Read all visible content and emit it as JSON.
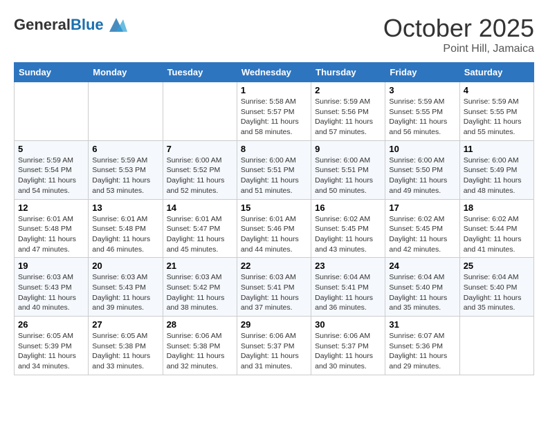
{
  "header": {
    "logo_general": "General",
    "logo_blue": "Blue",
    "month": "October 2025",
    "location": "Point Hill, Jamaica"
  },
  "weekdays": [
    "Sunday",
    "Monday",
    "Tuesday",
    "Wednesday",
    "Thursday",
    "Friday",
    "Saturday"
  ],
  "weeks": [
    [
      {
        "day": "",
        "info": ""
      },
      {
        "day": "",
        "info": ""
      },
      {
        "day": "",
        "info": ""
      },
      {
        "day": "1",
        "info": "Sunrise: 5:58 AM\nSunset: 5:57 PM\nDaylight: 11 hours and 58 minutes."
      },
      {
        "day": "2",
        "info": "Sunrise: 5:59 AM\nSunset: 5:56 PM\nDaylight: 11 hours and 57 minutes."
      },
      {
        "day": "3",
        "info": "Sunrise: 5:59 AM\nSunset: 5:55 PM\nDaylight: 11 hours and 56 minutes."
      },
      {
        "day": "4",
        "info": "Sunrise: 5:59 AM\nSunset: 5:55 PM\nDaylight: 11 hours and 55 minutes."
      }
    ],
    [
      {
        "day": "5",
        "info": "Sunrise: 5:59 AM\nSunset: 5:54 PM\nDaylight: 11 hours and 54 minutes."
      },
      {
        "day": "6",
        "info": "Sunrise: 5:59 AM\nSunset: 5:53 PM\nDaylight: 11 hours and 53 minutes."
      },
      {
        "day": "7",
        "info": "Sunrise: 6:00 AM\nSunset: 5:52 PM\nDaylight: 11 hours and 52 minutes."
      },
      {
        "day": "8",
        "info": "Sunrise: 6:00 AM\nSunset: 5:51 PM\nDaylight: 11 hours and 51 minutes."
      },
      {
        "day": "9",
        "info": "Sunrise: 6:00 AM\nSunset: 5:51 PM\nDaylight: 11 hours and 50 minutes."
      },
      {
        "day": "10",
        "info": "Sunrise: 6:00 AM\nSunset: 5:50 PM\nDaylight: 11 hours and 49 minutes."
      },
      {
        "day": "11",
        "info": "Sunrise: 6:00 AM\nSunset: 5:49 PM\nDaylight: 11 hours and 48 minutes."
      }
    ],
    [
      {
        "day": "12",
        "info": "Sunrise: 6:01 AM\nSunset: 5:48 PM\nDaylight: 11 hours and 47 minutes."
      },
      {
        "day": "13",
        "info": "Sunrise: 6:01 AM\nSunset: 5:48 PM\nDaylight: 11 hours and 46 minutes."
      },
      {
        "day": "14",
        "info": "Sunrise: 6:01 AM\nSunset: 5:47 PM\nDaylight: 11 hours and 45 minutes."
      },
      {
        "day": "15",
        "info": "Sunrise: 6:01 AM\nSunset: 5:46 PM\nDaylight: 11 hours and 44 minutes."
      },
      {
        "day": "16",
        "info": "Sunrise: 6:02 AM\nSunset: 5:45 PM\nDaylight: 11 hours and 43 minutes."
      },
      {
        "day": "17",
        "info": "Sunrise: 6:02 AM\nSunset: 5:45 PM\nDaylight: 11 hours and 42 minutes."
      },
      {
        "day": "18",
        "info": "Sunrise: 6:02 AM\nSunset: 5:44 PM\nDaylight: 11 hours and 41 minutes."
      }
    ],
    [
      {
        "day": "19",
        "info": "Sunrise: 6:03 AM\nSunset: 5:43 PM\nDaylight: 11 hours and 40 minutes."
      },
      {
        "day": "20",
        "info": "Sunrise: 6:03 AM\nSunset: 5:43 PM\nDaylight: 11 hours and 39 minutes."
      },
      {
        "day": "21",
        "info": "Sunrise: 6:03 AM\nSunset: 5:42 PM\nDaylight: 11 hours and 38 minutes."
      },
      {
        "day": "22",
        "info": "Sunrise: 6:03 AM\nSunset: 5:41 PM\nDaylight: 11 hours and 37 minutes."
      },
      {
        "day": "23",
        "info": "Sunrise: 6:04 AM\nSunset: 5:41 PM\nDaylight: 11 hours and 36 minutes."
      },
      {
        "day": "24",
        "info": "Sunrise: 6:04 AM\nSunset: 5:40 PM\nDaylight: 11 hours and 35 minutes."
      },
      {
        "day": "25",
        "info": "Sunrise: 6:04 AM\nSunset: 5:40 PM\nDaylight: 11 hours and 35 minutes."
      }
    ],
    [
      {
        "day": "26",
        "info": "Sunrise: 6:05 AM\nSunset: 5:39 PM\nDaylight: 11 hours and 34 minutes."
      },
      {
        "day": "27",
        "info": "Sunrise: 6:05 AM\nSunset: 5:38 PM\nDaylight: 11 hours and 33 minutes."
      },
      {
        "day": "28",
        "info": "Sunrise: 6:06 AM\nSunset: 5:38 PM\nDaylight: 11 hours and 32 minutes."
      },
      {
        "day": "29",
        "info": "Sunrise: 6:06 AM\nSunset: 5:37 PM\nDaylight: 11 hours and 31 minutes."
      },
      {
        "day": "30",
        "info": "Sunrise: 6:06 AM\nSunset: 5:37 PM\nDaylight: 11 hours and 30 minutes."
      },
      {
        "day": "31",
        "info": "Sunrise: 6:07 AM\nSunset: 5:36 PM\nDaylight: 11 hours and 29 minutes."
      },
      {
        "day": "",
        "info": ""
      }
    ]
  ]
}
